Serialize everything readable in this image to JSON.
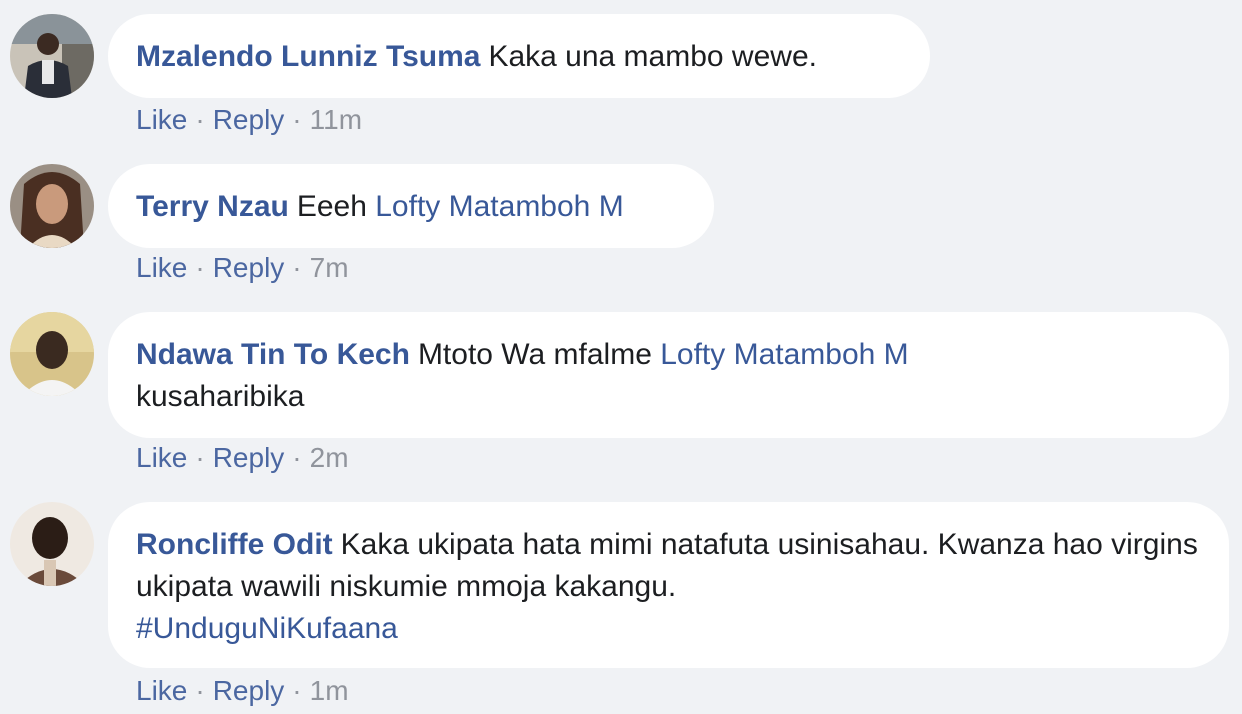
{
  "comments": [
    {
      "author": "Mzalendo Lunniz Tsuma",
      "text": "Kaka una mambo wewe.",
      "like": "Like",
      "reply": "Reply",
      "time": "11m"
    },
    {
      "author": "Terry Nzau",
      "text": "Eeeh",
      "mention": "Lofty Matamboh M",
      "like": "Like",
      "reply": "Reply",
      "time": "7m"
    },
    {
      "author": "Ndawa Tin To Kech",
      "text": "Mtoto Wa mfalme",
      "mention": "Lofty Matamboh M",
      "text_after": "kusaharibika",
      "like": "Like",
      "reply": "Reply",
      "time": "2m"
    },
    {
      "author": "Roncliffe Odit",
      "text": "Kaka ukipata hata mimi natafuta usinisahau. Kwanza hao virgins ukipata wawili niskumie mmoja kakangu.",
      "hashtag": "#UnduguNiKufaana",
      "like": "Like",
      "reply": "Reply",
      "time": "1m"
    }
  ],
  "separator": "·"
}
